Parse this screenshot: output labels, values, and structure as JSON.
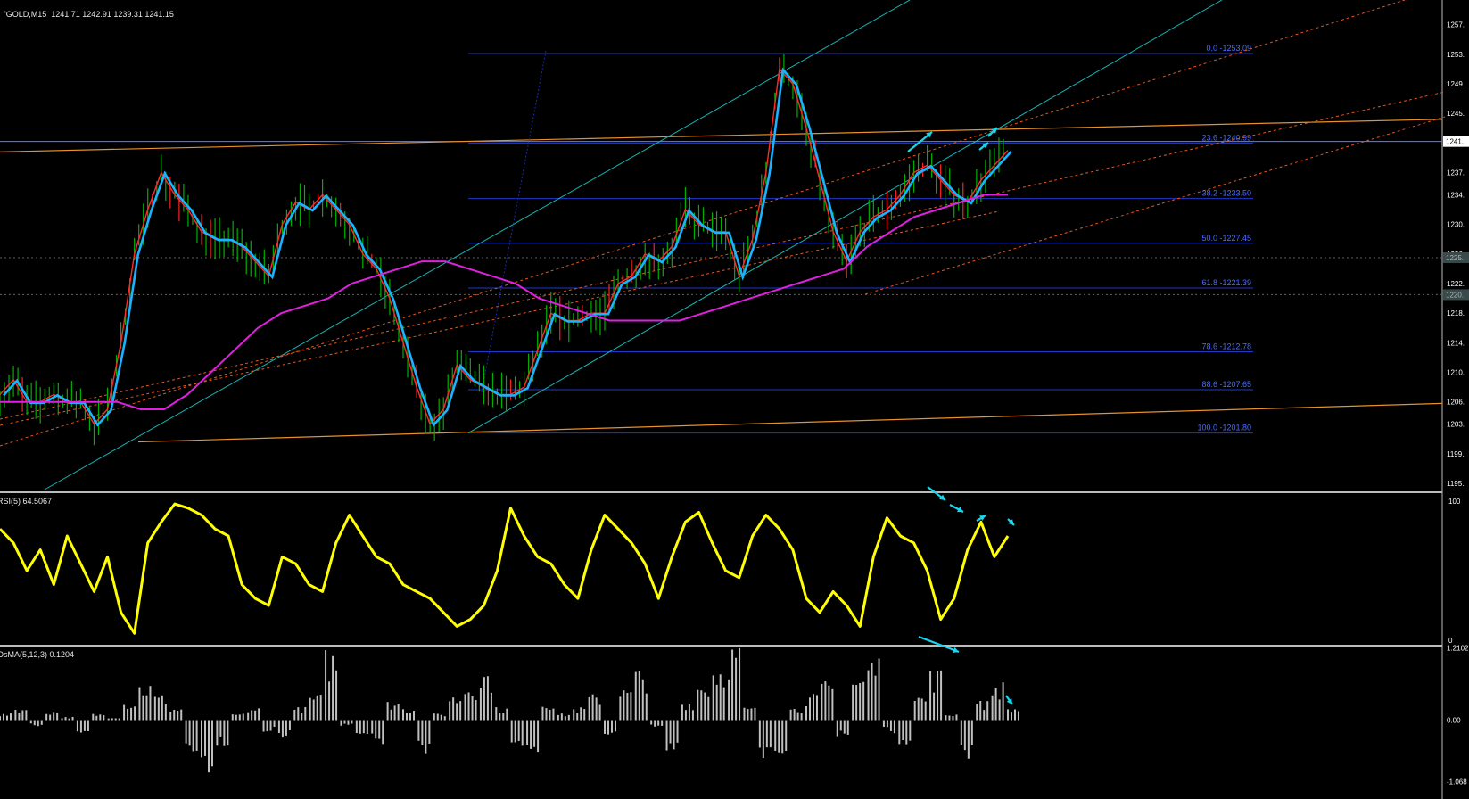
{
  "window": {
    "title": "GOLD,M15",
    "ohlc": "1241.71 1242.91 1239.31 1241.15",
    "title_prefix": "'"
  },
  "colors": {
    "background": "#000000",
    "axis": "#ffffff",
    "candles": "#00b000",
    "candles_red": "#ff2020",
    "ema_fast": "#ff2a2a",
    "ema_slow": "#19b3ff",
    "ma_long": "#e020e0",
    "fib": "#2038c8",
    "fib_text": "#4a6cff",
    "channel_teal": "#17b5b5",
    "channel_orange_dash": "#e8561a",
    "trend_orange": "#e8902a",
    "rsi": "#ffff00",
    "osma": "#c0c0c0",
    "arrows": "#18d6ee",
    "grid_dash": "#606060"
  },
  "main_panel": {
    "price_labels": [
      "1257.",
      "1253.",
      "1249.",
      "1245.",
      "1241.",
      "1237.",
      "1234.",
      "1230.",
      "1226.",
      "1222.",
      "1218.",
      "1214.",
      "1210.",
      "1206.",
      "1203.",
      "1199.",
      "1195."
    ],
    "current_price": "1241.",
    "marker_1": "1225.",
    "marker_2": "1220."
  },
  "fib_levels": [
    {
      "label": "0.0 -1253.09",
      "price": 1253.09
    },
    {
      "label": "23.6 -1240.99",
      "price": 1240.99
    },
    {
      "label": "38.2 -1233.50",
      "price": 1233.5
    },
    {
      "label": "50.0 -1227.45",
      "price": 1227.45
    },
    {
      "label": "61.8 -1221.39",
      "price": 1221.39
    },
    {
      "label": "78.6 -1212.78",
      "price": 1212.78
    },
    {
      "label": "88.6 -1207.65",
      "price": 1207.65
    },
    {
      "label": "100.0 -1201.80",
      "price": 1201.8
    }
  ],
  "rsi_panel": {
    "label": "RSI(5) 64.5067",
    "scale_max": "100",
    "scale_min": "0"
  },
  "osma_panel": {
    "label": "OsMA(5,12,3) 0.1204",
    "scale_max": "1.2102",
    "scale_mid": "0.00",
    "scale_min": "-1.068"
  },
  "chart_data": {
    "type": "line",
    "title": "GOLD,M15",
    "ylim": [
      1195,
      1259
    ],
    "price_path": [
      1207,
      1209,
      1206,
      1206,
      1207,
      1206,
      1206,
      1203,
      1205,
      1214,
      1226,
      1232,
      1237,
      1234,
      1232,
      1229,
      1228,
      1228,
      1227,
      1225,
      1223,
      1230,
      1233,
      1232,
      1234,
      1232,
      1230,
      1226,
      1224,
      1220,
      1214,
      1208,
      1203,
      1205,
      1211,
      1209,
      1208,
      1207,
      1207,
      1208,
      1213,
      1218,
      1217,
      1217,
      1218,
      1218,
      1222,
      1223,
      1226,
      1225,
      1227,
      1232,
      1230,
      1229,
      1229,
      1223,
      1228,
      1237,
      1251,
      1249,
      1243,
      1236,
      1229,
      1225,
      1229,
      1231,
      1232,
      1234,
      1237,
      1238,
      1236,
      1234,
      1233,
      1236,
      1238,
      1240
    ],
    "ma_long_path": [
      1206,
      1206,
      1206,
      1206,
      1206,
      1206,
      1205,
      1205,
      1207,
      1210,
      1213,
      1216,
      1218,
      1219,
      1220,
      1222,
      1223,
      1224,
      1225,
      1225,
      1224,
      1223,
      1222,
      1220,
      1219,
      1218,
      1217,
      1217,
      1217,
      1217,
      1218,
      1219,
      1220,
      1221,
      1222,
      1223,
      1224,
      1227,
      1229,
      1231,
      1232,
      1233,
      1234,
      1234
    ],
    "rsi_path": [
      80,
      70,
      50,
      65,
      40,
      75,
      55,
      35,
      60,
      20,
      5,
      70,
      85,
      98,
      95,
      90,
      80,
      75,
      40,
      30,
      25,
      60,
      55,
      40,
      35,
      70,
      90,
      75,
      60,
      55,
      40,
      35,
      30,
      20,
      10,
      15,
      25,
      50,
      95,
      75,
      60,
      55,
      40,
      30,
      65,
      90,
      80,
      70,
      55,
      30,
      60,
      85,
      92,
      70,
      50,
      45,
      75,
      90,
      80,
      65,
      30,
      20,
      35,
      25,
      10,
      60,
      88,
      75,
      70,
      50,
      15,
      30,
      65,
      85,
      60,
      75
    ],
    "osma_path": [
      0.1,
      0.2,
      -0.1,
      0.15,
      0.05,
      -0.2,
      0.1,
      0.05,
      0.3,
      0.6,
      0.4,
      0.2,
      -0.5,
      -0.8,
      -0.4,
      0.1,
      0.2,
      -0.2,
      -0.3,
      0.2,
      0.4,
      1.1,
      -0.1,
      -0.3,
      -0.4,
      0.3,
      0.2,
      -0.6,
      0.1,
      0.4,
      0.6,
      0.8,
      0.2,
      -0.4,
      -0.7,
      0.3,
      0.1,
      0.2,
      0.4,
      -0.3,
      0.5,
      0.8,
      -0.1,
      -0.5,
      0.3,
      0.6,
      0.9,
      1.2,
      0.2,
      -0.6,
      -0.9,
      0.2,
      0.4,
      0.6,
      -0.3,
      0.7,
      1.0,
      -0.2,
      -0.6,
      0.4,
      0.8,
      0.1,
      -0.7,
      0.3,
      0.6,
      0.2
    ]
  }
}
